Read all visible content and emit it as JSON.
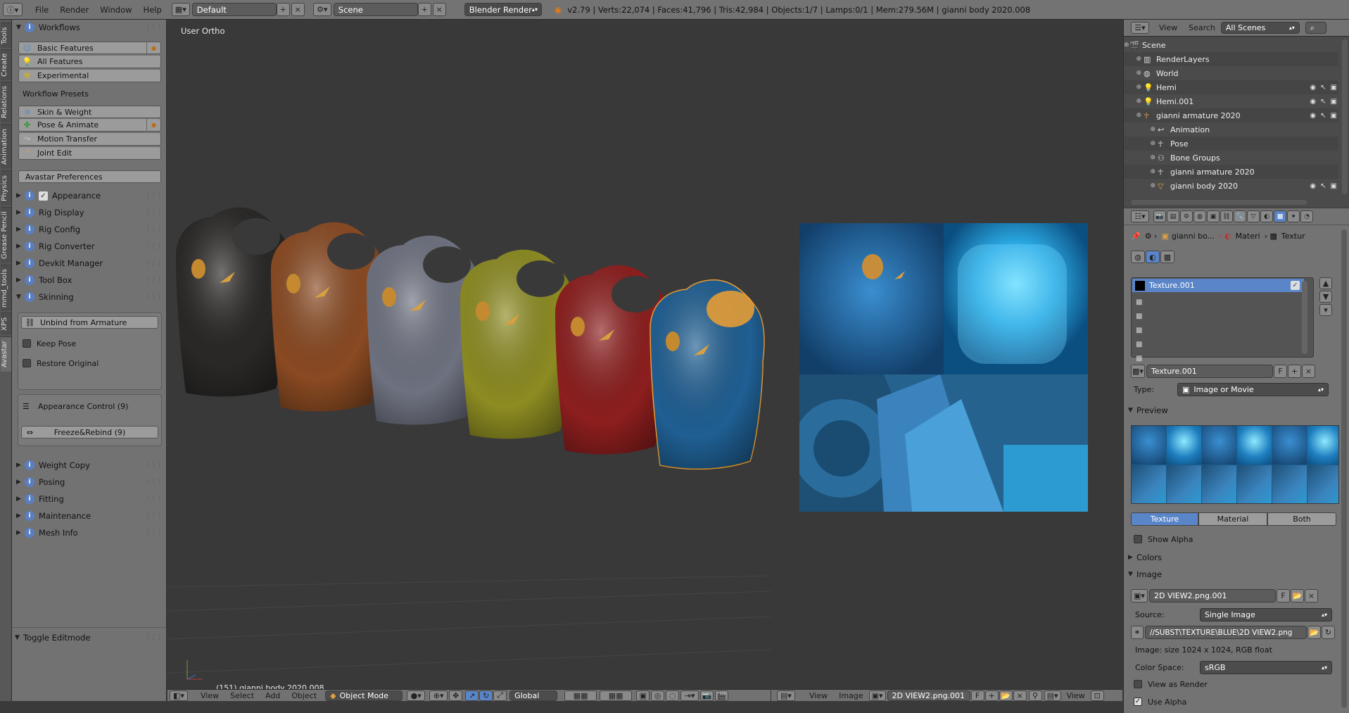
{
  "app": {
    "version_stats": "v2.79 | Verts:22,074 | Faces:41,796 | Tris:42,984 | Objects:1/7 | Lamps:0/1 | Mem:279.56M | gianni body 2020.008",
    "menus": [
      "File",
      "Render",
      "Window",
      "Help"
    ],
    "layout": "Default",
    "scene": "Scene",
    "engine": "Blender Render"
  },
  "tool_tabs": [
    "Tools",
    "Create",
    "Relations",
    "Animation",
    "Physics",
    "Grease Pencil",
    "mmd_tools",
    "XPS",
    "Avastar"
  ],
  "shelf": {
    "workflows_title": "Workflows",
    "workflows": [
      "Basic Features",
      "All Features",
      "Experimental"
    ],
    "presets_title": "Workflow Presets",
    "presets": [
      "Skin & Weight",
      "Pose & Animate",
      "Motion Transfer",
      "Joint Edit"
    ],
    "avastar_prefs": "Avastar Preferences",
    "panels_a": [
      "Appearance",
      "Rig Display",
      "Rig Config",
      "Rig Converter",
      "Devkit Manager",
      "Tool Box",
      "Skinning"
    ],
    "skinning": {
      "unbind": "Unbind from Armature",
      "keep_pose": "Keep Pose",
      "restore": "Restore Original",
      "appearance_control": "Appearance Control (9)",
      "freeze": "Freeze&Rebind (9)"
    },
    "panels_b": [
      "Weight Copy",
      "Posing",
      "Fitting",
      "Maintenance",
      "Mesh Info"
    ],
    "toggle_editmode": "Toggle Editmode"
  },
  "viewport3d": {
    "view_label": "User Ortho",
    "object_label": "(151) gianni body 2020.008",
    "footer": {
      "view": "View",
      "select": "Select",
      "add": "Add",
      "object": "Object",
      "mode": "Object Mode",
      "orientation": "Global"
    },
    "shirt_colors": [
      "#2a2826",
      "#8a4a22",
      "#6e7280",
      "#8d8c22",
      "#8d1e1e",
      "#1f5f93"
    ]
  },
  "uv_editor": {
    "footer": {
      "view": "View",
      "image": "Image",
      "image_name": "2D VIEW2.png.001",
      "f": "F",
      "view2": "View"
    }
  },
  "outliner": {
    "menus": [
      "View",
      "Search"
    ],
    "filter": "All Scenes",
    "rows": [
      {
        "label": "Scene",
        "indent": 0
      },
      {
        "label": "RenderLayers",
        "indent": 1
      },
      {
        "label": "World",
        "indent": 1
      },
      {
        "label": "Hemi",
        "indent": 1
      },
      {
        "label": "Hemi.001",
        "indent": 1
      },
      {
        "label": "gianni armature 2020",
        "indent": 1
      },
      {
        "label": "Animation",
        "indent": 2
      },
      {
        "label": "Pose",
        "indent": 2
      },
      {
        "label": "Bone Groups",
        "indent": 2
      },
      {
        "label": "gianni armature 2020",
        "indent": 2
      },
      {
        "label": "gianni body 2020",
        "indent": 2
      }
    ]
  },
  "properties": {
    "breadcrumb": [
      "gianni bo...",
      "Materi",
      "Textur"
    ],
    "texture_slot": "Texture.001",
    "texture_name": "Texture.001",
    "f": "F",
    "type_label": "Type:",
    "type_value": "Image or Movie",
    "preview_title": "Preview",
    "preview_tabs": [
      "Texture",
      "Material",
      "Both"
    ],
    "show_alpha": "Show Alpha",
    "colors_title": "Colors",
    "image_title": "Image",
    "image_name": "2D VIEW2.png.001",
    "source_label": "Source:",
    "source_value": "Single Image",
    "filepath": "//SUBST\\TEXTURE\\BLUE\\2D VIEW2.png",
    "image_info": "Image: size 1024 x 1024, RGB float",
    "color_space_label": "Color Space:",
    "color_space_value": "sRGB",
    "view_as_render": "View as Render",
    "use_alpha": "Use Alpha"
  }
}
